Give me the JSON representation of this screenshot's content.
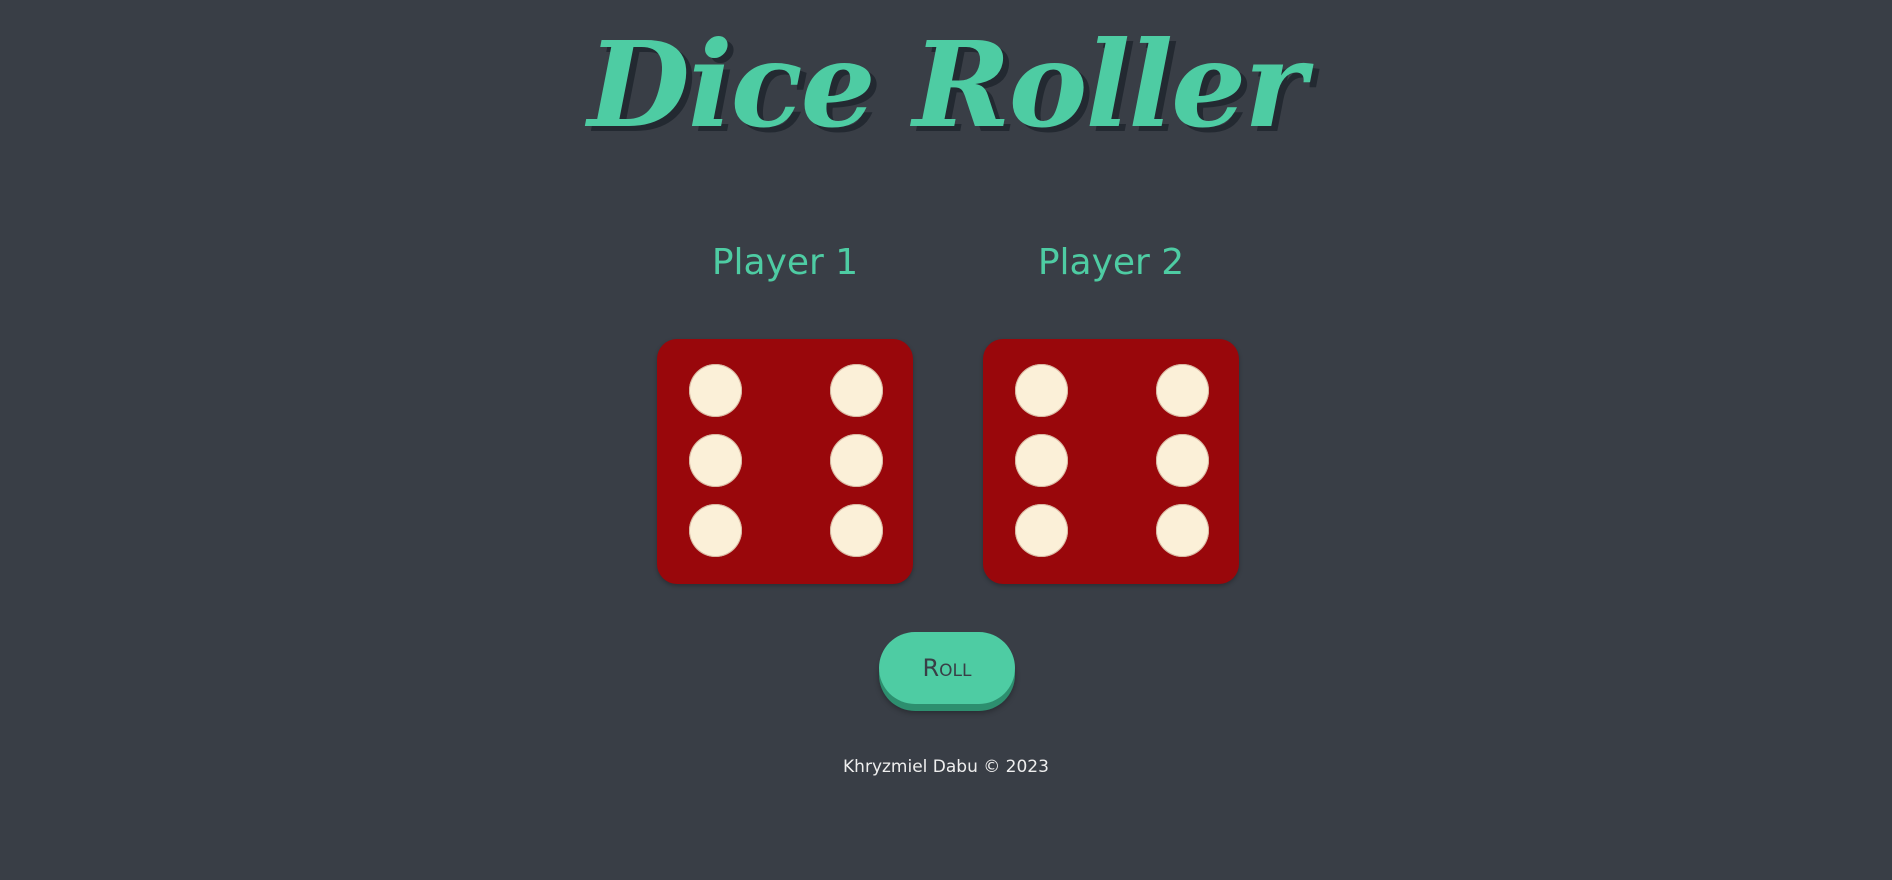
{
  "page": {
    "title": "Dice Roller",
    "colors": {
      "background": "#393e46",
      "accent": "#4ecca3",
      "die": "#99070b",
      "pip": "#fbf0d8",
      "footer_text": "#eeeeee"
    }
  },
  "players": [
    {
      "label": "Player 1",
      "die_value": 6,
      "die_icon": "die-six-icon"
    },
    {
      "label": "Player 2",
      "die_value": 6,
      "die_icon": "die-six-icon"
    }
  ],
  "controls": {
    "roll_label": "Roll"
  },
  "footer": {
    "text": "Khryzmiel Dabu © 2023"
  }
}
